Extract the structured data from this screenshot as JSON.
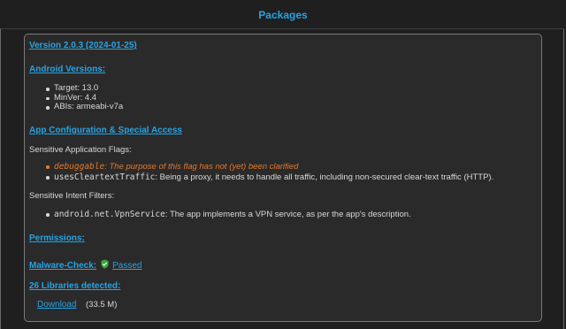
{
  "page": {
    "title": "Packages"
  },
  "package": {
    "version_link": "Version 2.0.3 (2024-01-25)",
    "android_versions": {
      "heading": "Android Versions:",
      "items": [
        "Target: 13.0",
        "MinVer: 4.4",
        "ABIs: armeabi-v7a"
      ]
    },
    "app_config": {
      "heading": "App Configuration & Special Access",
      "flags_label": "Sensitive Application Flags:",
      "flags": [
        {
          "code": "debuggable",
          "text": ": The purpose of this flag has not (yet) been clarified",
          "status": "warning"
        },
        {
          "code": "usesCleartextTraffic",
          "text": ": Being a proxy, it needs to handle all traffic, including non-secured clear-text traffic (HTTP).",
          "status": "normal"
        }
      ],
      "intents_label": "Sensitive Intent Filters:",
      "intents": [
        {
          "code": "android.net.VpnService",
          "text": ": The app implements a VPN service, as per the app's description."
        }
      ]
    },
    "permissions_heading": "Permissions:",
    "malware": {
      "heading": "Malware-Check:",
      "status_icon": "shield-check-icon",
      "status_link": "Passed"
    },
    "libraries_heading": "26 Libraries detected:",
    "download": {
      "link": "Download",
      "size": "(33.5 M)"
    }
  },
  "colors": {
    "accent": "#27a3e3",
    "warning": "#e07a2f",
    "passed": "#3aa53a",
    "background": "#1f1f1f",
    "card": "#2a2a2a"
  }
}
